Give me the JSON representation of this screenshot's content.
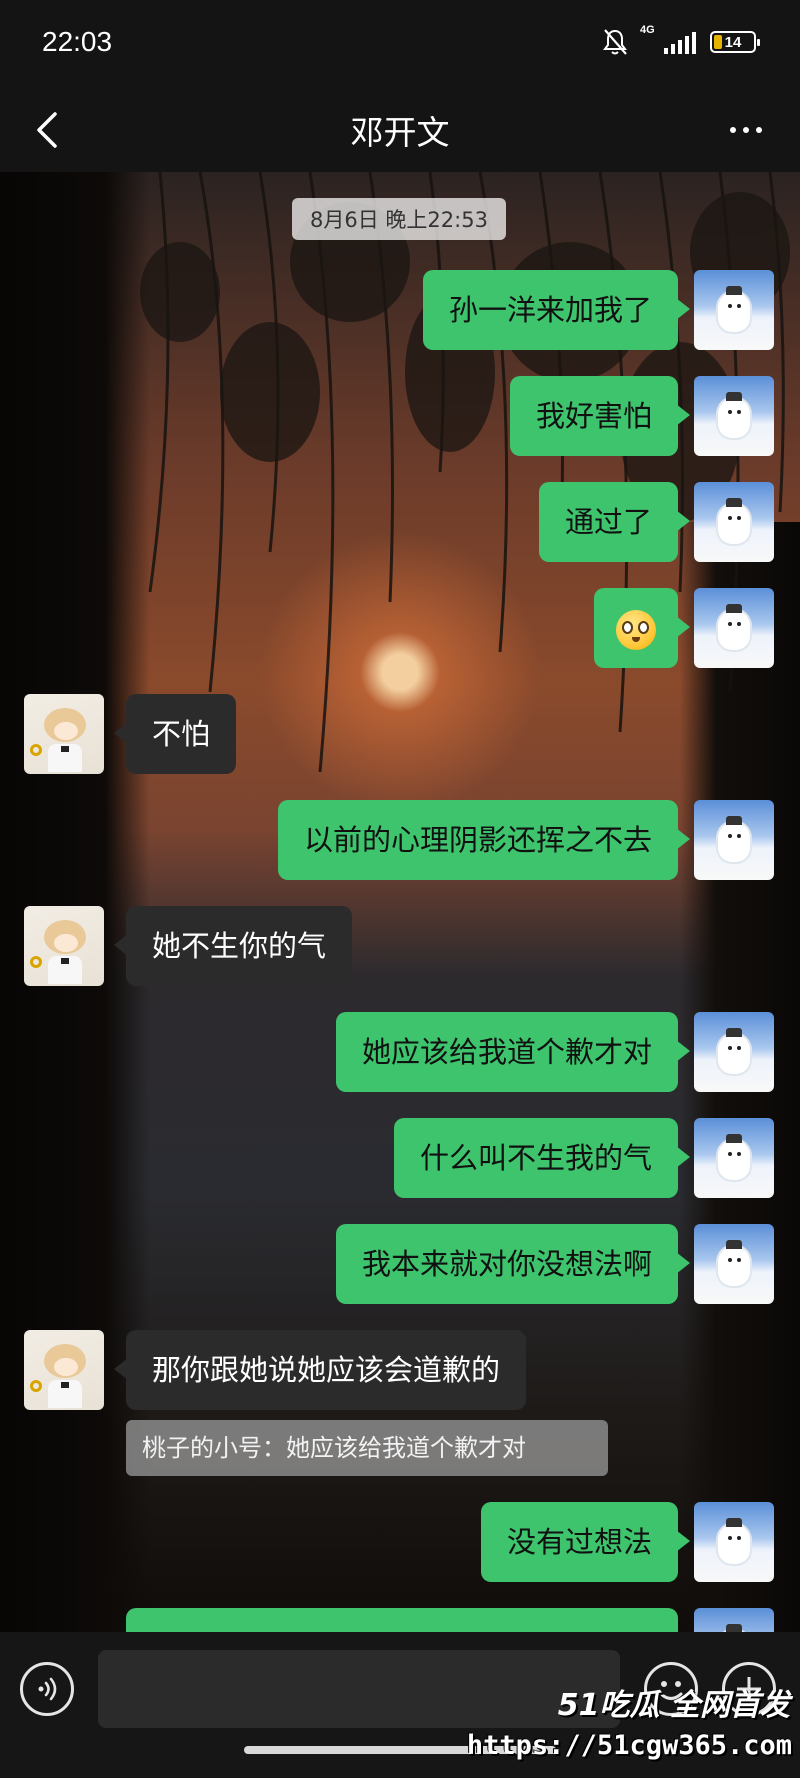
{
  "status_bar": {
    "time": "22:03",
    "network": "4G",
    "battery": "14"
  },
  "header": {
    "title": "邓开文"
  },
  "chat": {
    "timestamp": "8月6日 晚上22:53",
    "messages": [
      {
        "side": "out",
        "text": "孙一洋来加我了"
      },
      {
        "side": "out",
        "text": "我好害怕"
      },
      {
        "side": "out",
        "text": "通过了"
      },
      {
        "side": "out",
        "type": "emoji",
        "icon": "pleading-face-emoji"
      },
      {
        "side": "in",
        "text": "不怕"
      },
      {
        "side": "out",
        "text": "以前的心理阴影还挥之不去"
      },
      {
        "side": "in",
        "text": "她不生你的气"
      },
      {
        "side": "out",
        "text": "她应该给我道个歉才对"
      },
      {
        "side": "out",
        "text": "什么叫不生我的气"
      },
      {
        "side": "out",
        "text": "我本来就对你没想法啊"
      },
      {
        "side": "in",
        "text": "那你跟她说她应该会道歉的"
      },
      {
        "side": "out",
        "text": "没有过想法"
      }
    ],
    "quote": "桃子的小号：她应该给我道个歉才对"
  },
  "input": {
    "placeholder": ""
  },
  "watermark": {
    "logo": "51吃瓜 全网首发",
    "url": "https://51cgw365.com"
  },
  "colors": {
    "outgoing_bubble": "#3dc46d",
    "incoming_bubble": "#2b2b2b",
    "bar_background": "#141414"
  }
}
